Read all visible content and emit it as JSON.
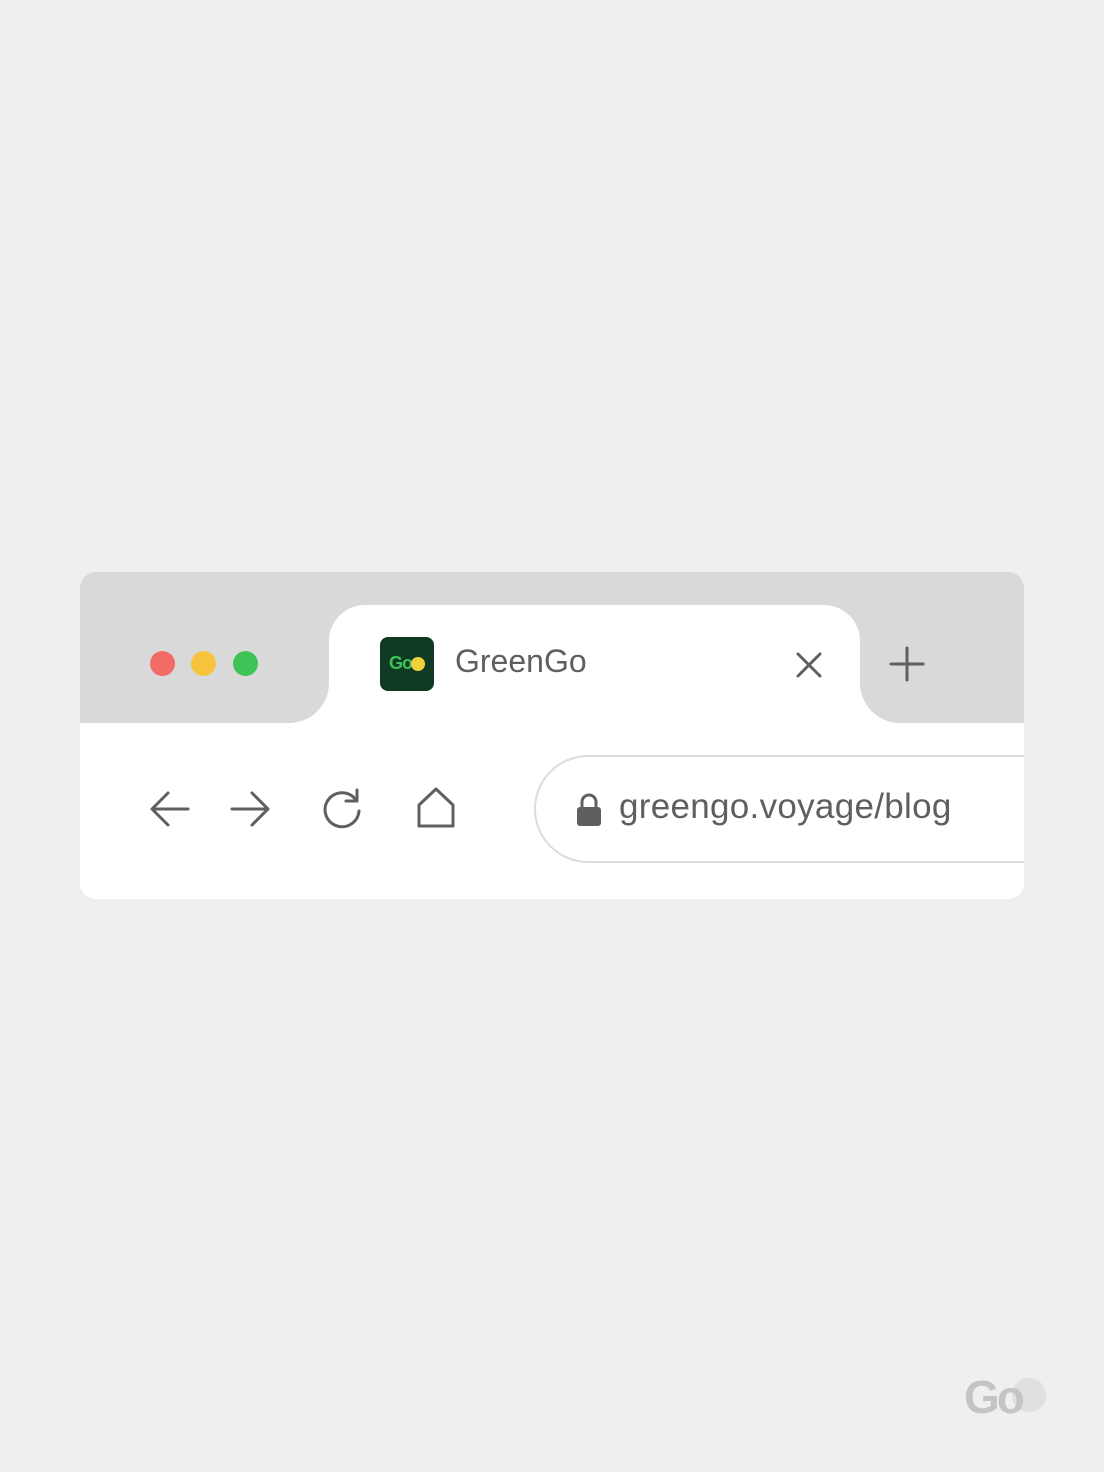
{
  "window_controls": {
    "close_color": "#f26b66",
    "minimize_color": "#f8c33c",
    "zoom_color": "#3ec356"
  },
  "tab": {
    "title": "GreenGo",
    "favicon_text": "Go",
    "favicon_bg": "#0f3a24",
    "close_icon": "close-icon"
  },
  "new_tab_icon": "plus-icon",
  "toolbar": {
    "back_icon": "arrow-left-icon",
    "forward_icon": "arrow-right-icon",
    "reload_icon": "reload-icon",
    "home_icon": "home-icon"
  },
  "address_bar": {
    "lock_icon": "lock-icon",
    "url": "greengo.voyage/blog"
  },
  "watermark": {
    "text": "Go"
  }
}
